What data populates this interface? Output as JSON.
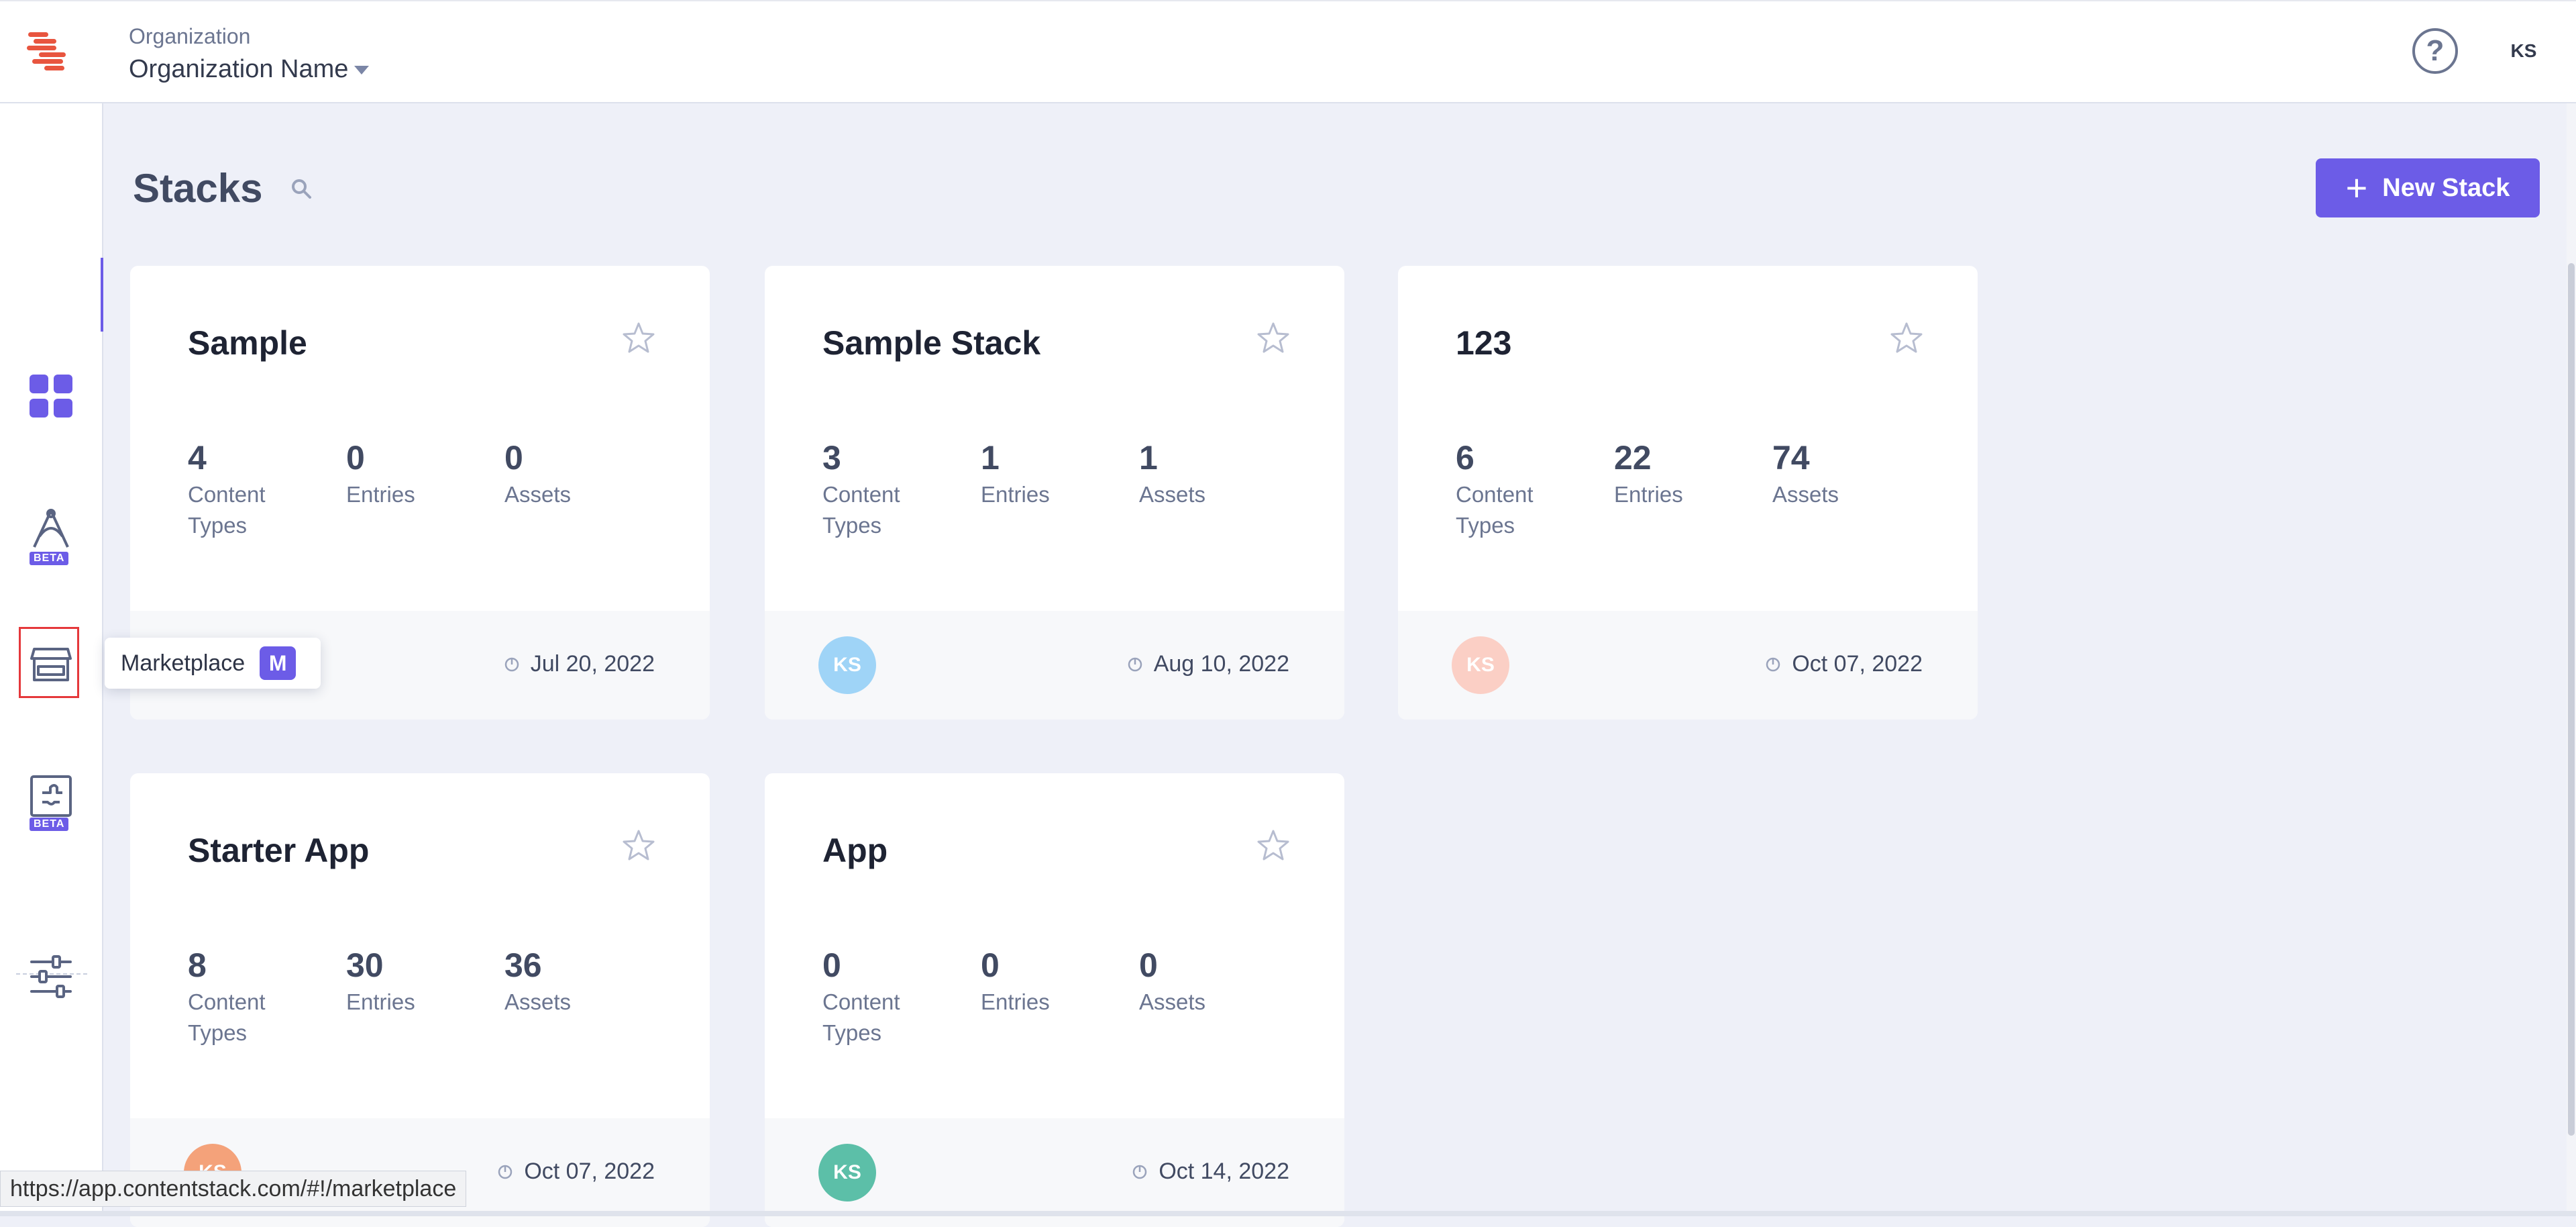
{
  "header": {
    "org_label": "Organization",
    "org_name": "Organization Name",
    "user_initials": "KS"
  },
  "sidebar": {
    "items": [
      {
        "name": "dashboard",
        "icon": "grid-icon"
      },
      {
        "name": "automate",
        "icon": "automate-icon",
        "badge": "BETA"
      },
      {
        "name": "marketplace",
        "icon": "store-icon"
      },
      {
        "name": "extensions",
        "icon": "puzzle-icon",
        "badge": "BETA"
      },
      {
        "name": "settings",
        "icon": "sliders-icon"
      }
    ]
  },
  "tooltip": {
    "label": "Marketplace",
    "shortcut": "M"
  },
  "page": {
    "title": "Stacks",
    "new_stack_label": "New Stack"
  },
  "stacks": [
    {
      "name": "Sample",
      "content_types": "4",
      "entries": "0",
      "assets": "0",
      "avatar": "",
      "avatar_color": "#ffffff",
      "date": "Jul 20, 2022"
    },
    {
      "name": "Sample Stack",
      "content_types": "3",
      "entries": "1",
      "assets": "1",
      "avatar": "KS",
      "avatar_color": "#9fd4f7",
      "date": "Aug 10, 2022"
    },
    {
      "name": "123",
      "content_types": "6",
      "entries": "22",
      "assets": "74",
      "avatar": "KS",
      "avatar_color": "#fbcfc5",
      "date": "Oct 07, 2022"
    },
    {
      "name": "Starter App",
      "content_types": "8",
      "entries": "30",
      "assets": "36",
      "avatar": "KS",
      "avatar_color": "#f4a27a",
      "date": "Oct 07, 2022"
    },
    {
      "name": "App",
      "content_types": "0",
      "entries": "0",
      "assets": "0",
      "avatar": "KS",
      "avatar_color": "#5cbfa8",
      "date": "Oct 14, 2022"
    }
  ],
  "labels": {
    "content": "Content",
    "types": "Types",
    "entries": "Entries",
    "assets": "Assets"
  },
  "status_bar": {
    "url": "https://app.contentstack.com/#!/marketplace"
  },
  "colors": {
    "accent": "#6c5ce7",
    "logo": "#e8553f"
  }
}
